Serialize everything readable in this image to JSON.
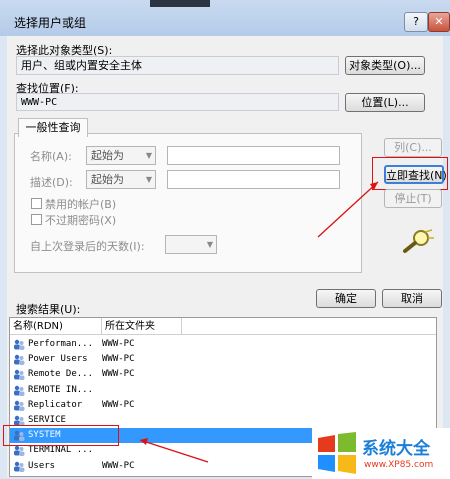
{
  "window": {
    "title": "选择用户或组",
    "help_btn": "?",
    "close_btn": "✕"
  },
  "object_type": {
    "label": "选择此对象类型(S):",
    "value": "用户、组或内置安全主体",
    "button": "对象类型(O)..."
  },
  "location": {
    "label": "查找位置(F):",
    "value": "WWW-PC",
    "button": "位置(L)..."
  },
  "query": {
    "tab": "一般性查询",
    "name_label": "名称(A):",
    "name_combo": "起始为",
    "desc_label": "描述(D):",
    "desc_combo": "起始为",
    "disabled_accounts": "禁用的帐户(B)",
    "no_expire_pwd": "不过期密码(X)",
    "days_label": "自上次登录后的天数(I):"
  },
  "buttons": {
    "columns": "列(C)...",
    "find_now": "立即查找(N)",
    "stop": "停止(T)",
    "ok": "确定",
    "cancel": "取消"
  },
  "results": {
    "label": "搜索结果(U):",
    "columns": [
      "名称(RDN)",
      "所在文件夹"
    ],
    "rows": [
      {
        "name": "Performan...",
        "folder": "WWW-PC"
      },
      {
        "name": "Power Users",
        "folder": "WWW-PC"
      },
      {
        "name": "Remote De...",
        "folder": "WWW-PC"
      },
      {
        "name": "REMOTE IN...",
        "folder": ""
      },
      {
        "name": "Replicator",
        "folder": "WWW-PC"
      },
      {
        "name": "SERVICE",
        "folder": ""
      },
      {
        "name": "SYSTEM",
        "folder": ""
      },
      {
        "name": "TERMINAL ...",
        "folder": ""
      },
      {
        "name": "Users",
        "folder": "WWW-PC"
      }
    ]
  },
  "watermark": {
    "text": "系统大全",
    "url": "www.XP85.com"
  },
  "colors": {
    "selection": "#3399ff",
    "annotation": "#d11111"
  }
}
